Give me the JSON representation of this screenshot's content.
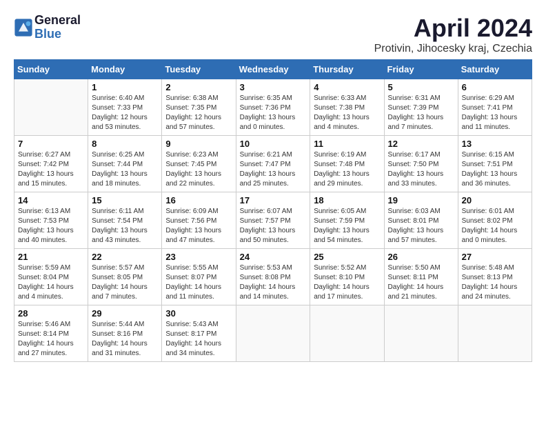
{
  "header": {
    "logo_line1": "General",
    "logo_line2": "Blue",
    "title": "April 2024",
    "subtitle": "Protivin, Jihocesky kraj, Czechia"
  },
  "days_of_week": [
    "Sunday",
    "Monday",
    "Tuesday",
    "Wednesday",
    "Thursday",
    "Friday",
    "Saturday"
  ],
  "weeks": [
    [
      {
        "day": "",
        "info": ""
      },
      {
        "day": "1",
        "info": "Sunrise: 6:40 AM\nSunset: 7:33 PM\nDaylight: 12 hours\nand 53 minutes."
      },
      {
        "day": "2",
        "info": "Sunrise: 6:38 AM\nSunset: 7:35 PM\nDaylight: 12 hours\nand 57 minutes."
      },
      {
        "day": "3",
        "info": "Sunrise: 6:35 AM\nSunset: 7:36 PM\nDaylight: 13 hours\nand 0 minutes."
      },
      {
        "day": "4",
        "info": "Sunrise: 6:33 AM\nSunset: 7:38 PM\nDaylight: 13 hours\nand 4 minutes."
      },
      {
        "day": "5",
        "info": "Sunrise: 6:31 AM\nSunset: 7:39 PM\nDaylight: 13 hours\nand 7 minutes."
      },
      {
        "day": "6",
        "info": "Sunrise: 6:29 AM\nSunset: 7:41 PM\nDaylight: 13 hours\nand 11 minutes."
      }
    ],
    [
      {
        "day": "7",
        "info": "Sunrise: 6:27 AM\nSunset: 7:42 PM\nDaylight: 13 hours\nand 15 minutes."
      },
      {
        "day": "8",
        "info": "Sunrise: 6:25 AM\nSunset: 7:44 PM\nDaylight: 13 hours\nand 18 minutes."
      },
      {
        "day": "9",
        "info": "Sunrise: 6:23 AM\nSunset: 7:45 PM\nDaylight: 13 hours\nand 22 minutes."
      },
      {
        "day": "10",
        "info": "Sunrise: 6:21 AM\nSunset: 7:47 PM\nDaylight: 13 hours\nand 25 minutes."
      },
      {
        "day": "11",
        "info": "Sunrise: 6:19 AM\nSunset: 7:48 PM\nDaylight: 13 hours\nand 29 minutes."
      },
      {
        "day": "12",
        "info": "Sunrise: 6:17 AM\nSunset: 7:50 PM\nDaylight: 13 hours\nand 33 minutes."
      },
      {
        "day": "13",
        "info": "Sunrise: 6:15 AM\nSunset: 7:51 PM\nDaylight: 13 hours\nand 36 minutes."
      }
    ],
    [
      {
        "day": "14",
        "info": "Sunrise: 6:13 AM\nSunset: 7:53 PM\nDaylight: 13 hours\nand 40 minutes."
      },
      {
        "day": "15",
        "info": "Sunrise: 6:11 AM\nSunset: 7:54 PM\nDaylight: 13 hours\nand 43 minutes."
      },
      {
        "day": "16",
        "info": "Sunrise: 6:09 AM\nSunset: 7:56 PM\nDaylight: 13 hours\nand 47 minutes."
      },
      {
        "day": "17",
        "info": "Sunrise: 6:07 AM\nSunset: 7:57 PM\nDaylight: 13 hours\nand 50 minutes."
      },
      {
        "day": "18",
        "info": "Sunrise: 6:05 AM\nSunset: 7:59 PM\nDaylight: 13 hours\nand 54 minutes."
      },
      {
        "day": "19",
        "info": "Sunrise: 6:03 AM\nSunset: 8:01 PM\nDaylight: 13 hours\nand 57 minutes."
      },
      {
        "day": "20",
        "info": "Sunrise: 6:01 AM\nSunset: 8:02 PM\nDaylight: 14 hours\nand 0 minutes."
      }
    ],
    [
      {
        "day": "21",
        "info": "Sunrise: 5:59 AM\nSunset: 8:04 PM\nDaylight: 14 hours\nand 4 minutes."
      },
      {
        "day": "22",
        "info": "Sunrise: 5:57 AM\nSunset: 8:05 PM\nDaylight: 14 hours\nand 7 minutes."
      },
      {
        "day": "23",
        "info": "Sunrise: 5:55 AM\nSunset: 8:07 PM\nDaylight: 14 hours\nand 11 minutes."
      },
      {
        "day": "24",
        "info": "Sunrise: 5:53 AM\nSunset: 8:08 PM\nDaylight: 14 hours\nand 14 minutes."
      },
      {
        "day": "25",
        "info": "Sunrise: 5:52 AM\nSunset: 8:10 PM\nDaylight: 14 hours\nand 17 minutes."
      },
      {
        "day": "26",
        "info": "Sunrise: 5:50 AM\nSunset: 8:11 PM\nDaylight: 14 hours\nand 21 minutes."
      },
      {
        "day": "27",
        "info": "Sunrise: 5:48 AM\nSunset: 8:13 PM\nDaylight: 14 hours\nand 24 minutes."
      }
    ],
    [
      {
        "day": "28",
        "info": "Sunrise: 5:46 AM\nSunset: 8:14 PM\nDaylight: 14 hours\nand 27 minutes."
      },
      {
        "day": "29",
        "info": "Sunrise: 5:44 AM\nSunset: 8:16 PM\nDaylight: 14 hours\nand 31 minutes."
      },
      {
        "day": "30",
        "info": "Sunrise: 5:43 AM\nSunset: 8:17 PM\nDaylight: 14 hours\nand 34 minutes."
      },
      {
        "day": "",
        "info": ""
      },
      {
        "day": "",
        "info": ""
      },
      {
        "day": "",
        "info": ""
      },
      {
        "day": "",
        "info": ""
      }
    ]
  ]
}
